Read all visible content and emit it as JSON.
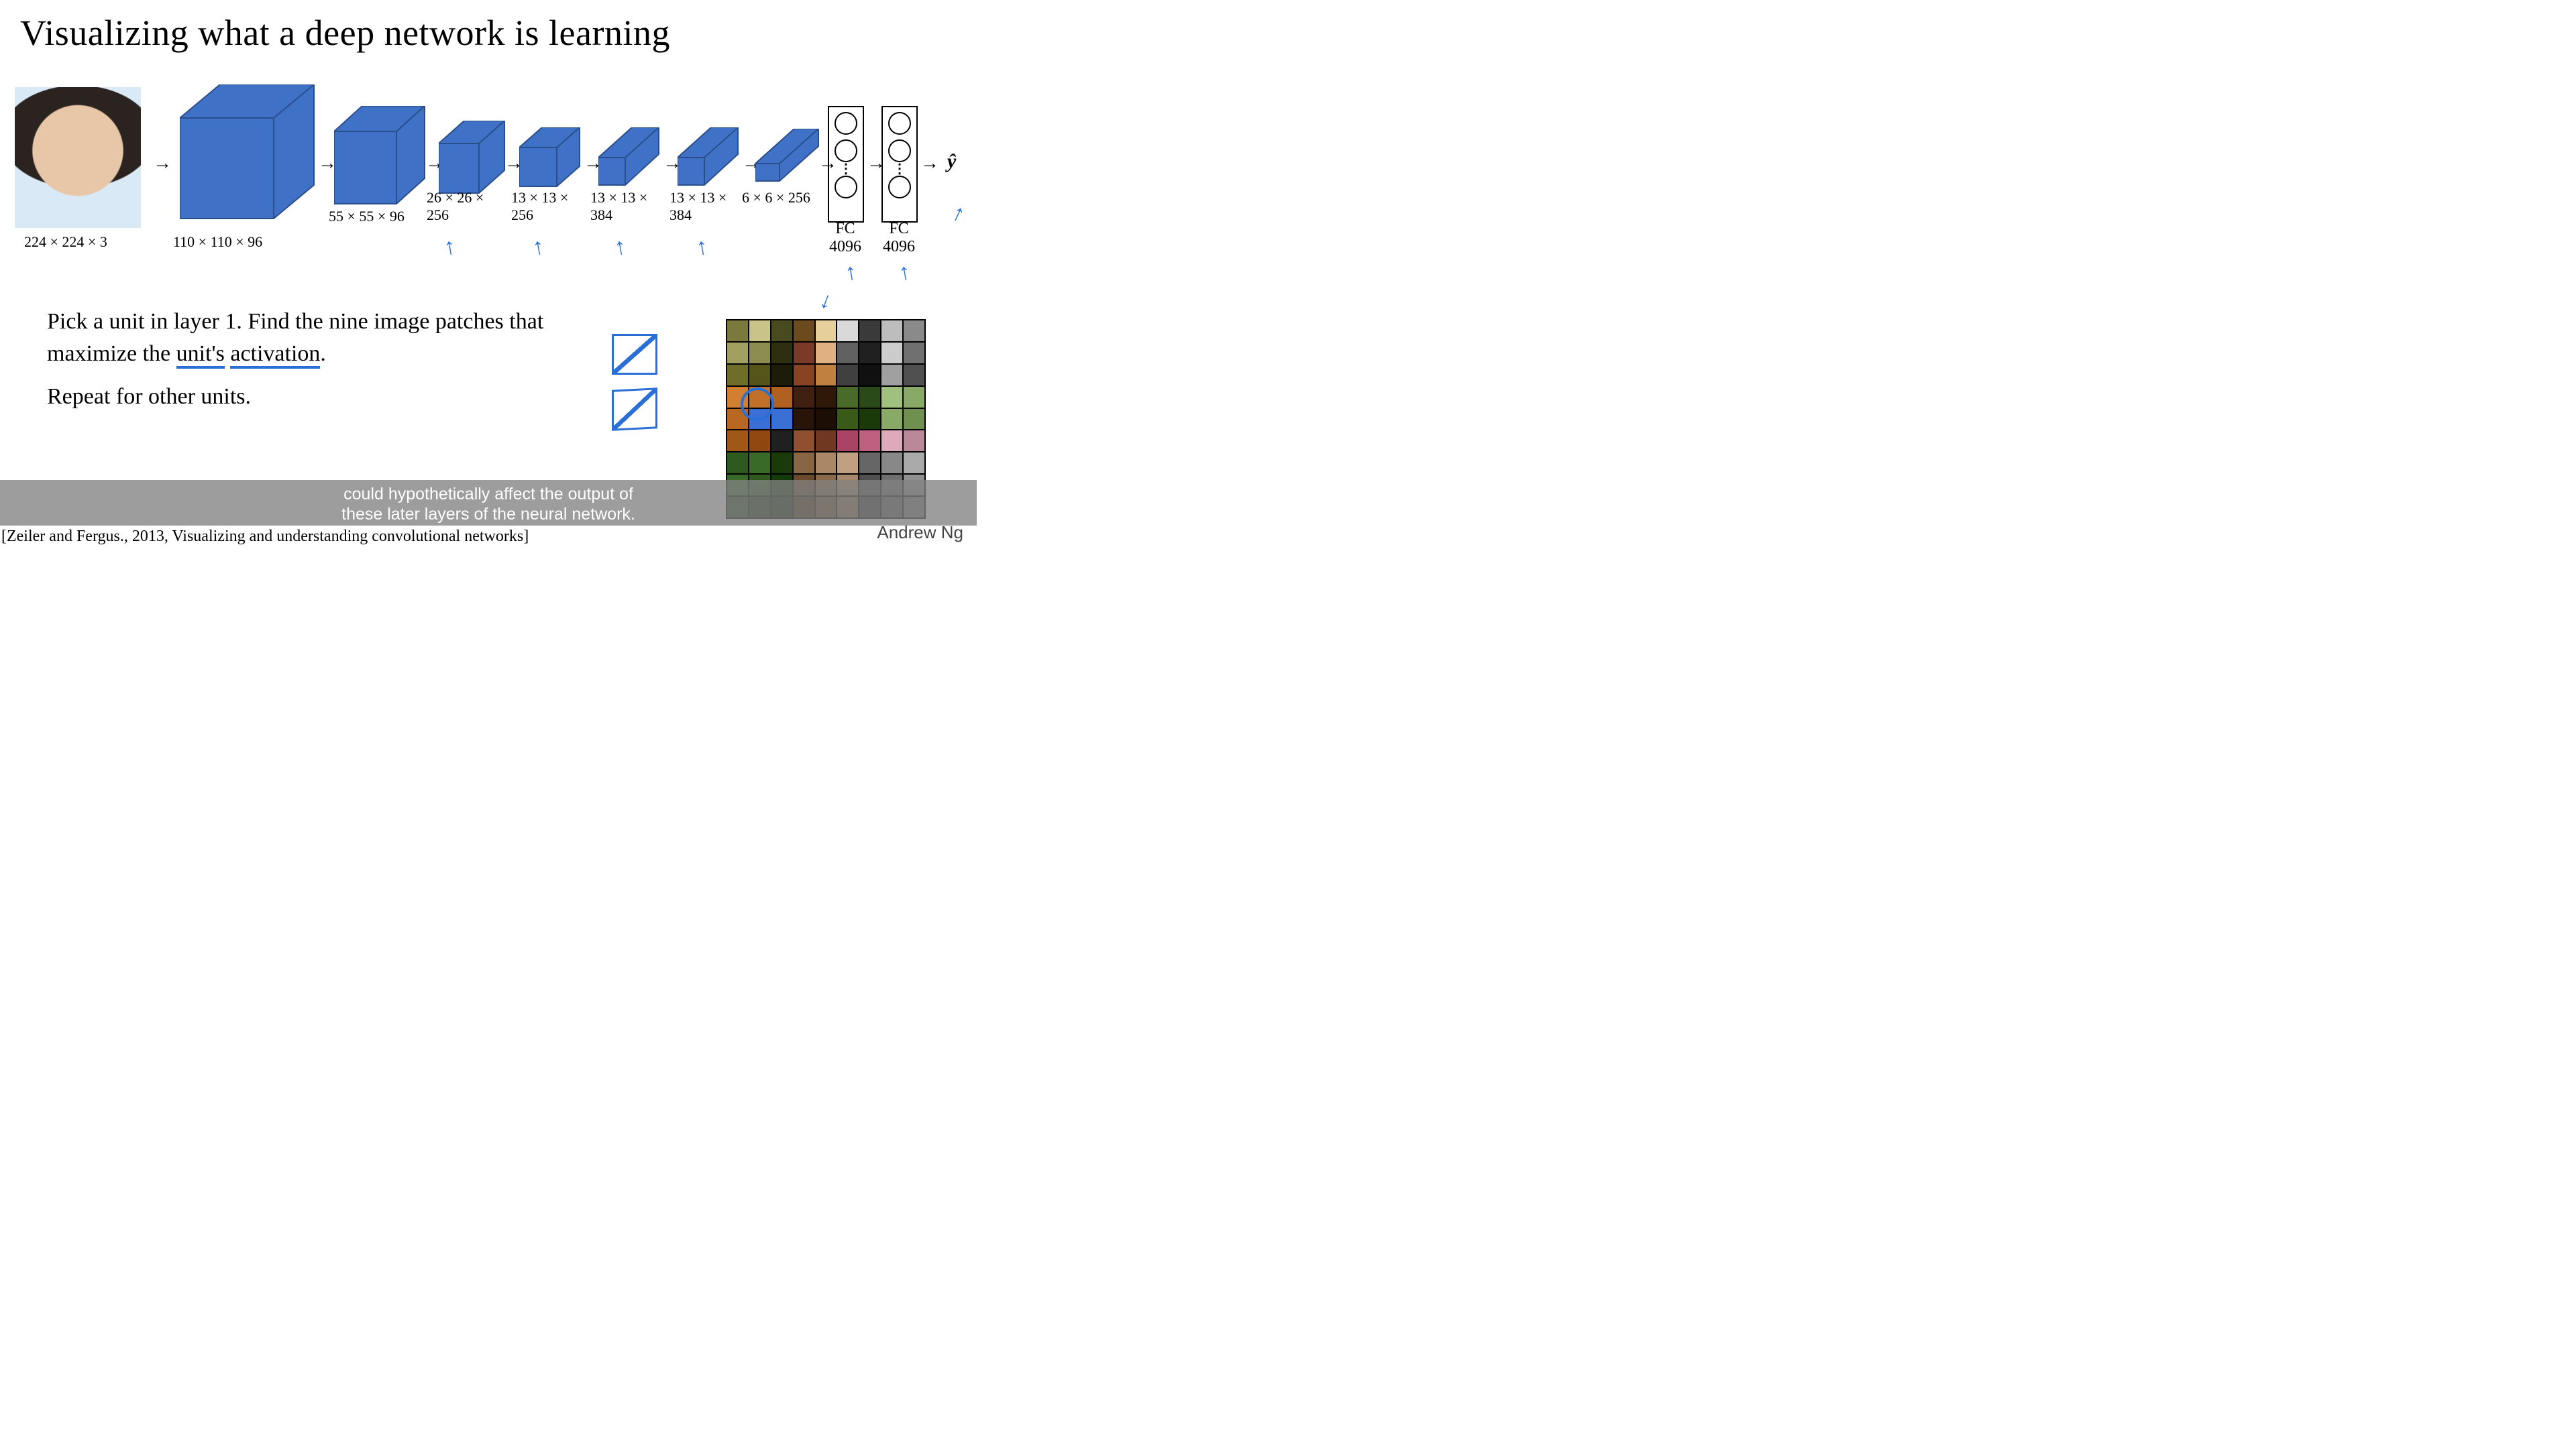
{
  "title": "Visualizing what a deep network is learning",
  "layers": [
    {
      "dim": "224 × 224 × 3"
    },
    {
      "dim": "110 × 110 × 96"
    },
    {
      "dim": "55 × 55 × 96"
    },
    {
      "dim": "26 × 26 × 256"
    },
    {
      "dim": "13 × 13 × 256"
    },
    {
      "dim": "13 × 13 × 384"
    },
    {
      "dim": "13 × 13 × 384"
    },
    {
      "dim": "6 × 6 × 256"
    }
  ],
  "fc": [
    {
      "label": "FC",
      "size": "4096"
    },
    {
      "label": "FC",
      "size": "4096"
    }
  ],
  "output": "ŷ",
  "body": {
    "p1a": "Pick a unit in layer 1. Find the nine image patches that maximize the ",
    "p1b": "unit's",
    "p1c": " ",
    "p1d": "activation",
    "p1e": ".",
    "p2": "Repeat for other units."
  },
  "caption_line1": "could hypothetically affect the output of",
  "caption_line2": "these later layers of the neural network.",
  "reference": "[Zeiler and Fergus., 2013, Visualizing and understanding convolutional networks]",
  "presenter": "Andrew Ng",
  "patch_colors": [
    "#7b7a3d",
    "#c9c38a",
    "#4a4a20",
    "#6b4a1e",
    "#e6cf9a",
    "#d9d9d9",
    "#3a3a3a",
    "#bdbdbd",
    "#8a8a8a",
    "#a2a060",
    "#8c8c50",
    "#2e2e10",
    "#7a3a2a",
    "#e0b080",
    "#606060",
    "#202020",
    "#cccccc",
    "#707070",
    "#6e6e2a",
    "#55551a",
    "#1c1c08",
    "#884422",
    "#c08040",
    "#404040",
    "#101010",
    "#a0a0a0",
    "#505050",
    "#d08030",
    "#c07028",
    "#b06020",
    "#402010",
    "#301808",
    "#4a6a2a",
    "#2a4a1a",
    "#a0c080",
    "#88aa66",
    "#b86820",
    "#3a6fd6",
    "#3a6fd6",
    "#281408",
    "#1c0e04",
    "#3a5a1a",
    "#1a3a0a",
    "#88aa66",
    "#709050",
    "#a05818",
    "#904810",
    "#202020",
    "#905030",
    "#703820",
    "#aa4466",
    "#c06080",
    "#ddaabb",
    "#bb8899",
    "#2e5a1e",
    "#3a6a2a",
    "#1a3a0a",
    "#886644",
    "#aa8866",
    "#c0a080",
    "#666666",
    "#888888",
    "#aaaaaa",
    "#3a6a2a",
    "#2e5a1e",
    "#143a0a",
    "#6a4a2a",
    "#8a6a4a",
    "#a8886a",
    "#505050",
    "#707070",
    "#909090",
    "#2a4a1a",
    "#1e3a0e",
    "#0e2a06",
    "#4a3010",
    "#6a5030",
    "#8a7050",
    "#3a3a3a",
    "#5a5a5a",
    "#7a7a7a"
  ]
}
